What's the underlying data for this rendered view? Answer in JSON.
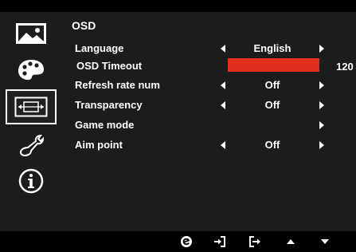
{
  "menu": {
    "title": "OSD",
    "items": [
      {
        "label": "Language",
        "value": "English"
      },
      {
        "label": "OSD Timeout",
        "value": "120",
        "level": 1.0
      },
      {
        "label": "Refresh rate num",
        "value": "Off"
      },
      {
        "label": "Transparency",
        "value": "Off"
      },
      {
        "label": "Game mode",
        "value": ""
      },
      {
        "label": "Aim point",
        "value": "Off"
      }
    ]
  },
  "sidebar": {
    "items": [
      {
        "icon": "picture-icon"
      },
      {
        "icon": "palette-icon"
      },
      {
        "icon": "osd-icon",
        "active": true
      },
      {
        "icon": "wrench-icon"
      },
      {
        "icon": "info-icon"
      }
    ]
  },
  "keys": [
    "e-key-icon",
    "enter-icon",
    "exit-icon",
    "up-arrow-icon",
    "down-arrow-icon"
  ],
  "colors": {
    "accent": "#e0301e",
    "panel": "#1c1c1c",
    "background": "#000000"
  }
}
